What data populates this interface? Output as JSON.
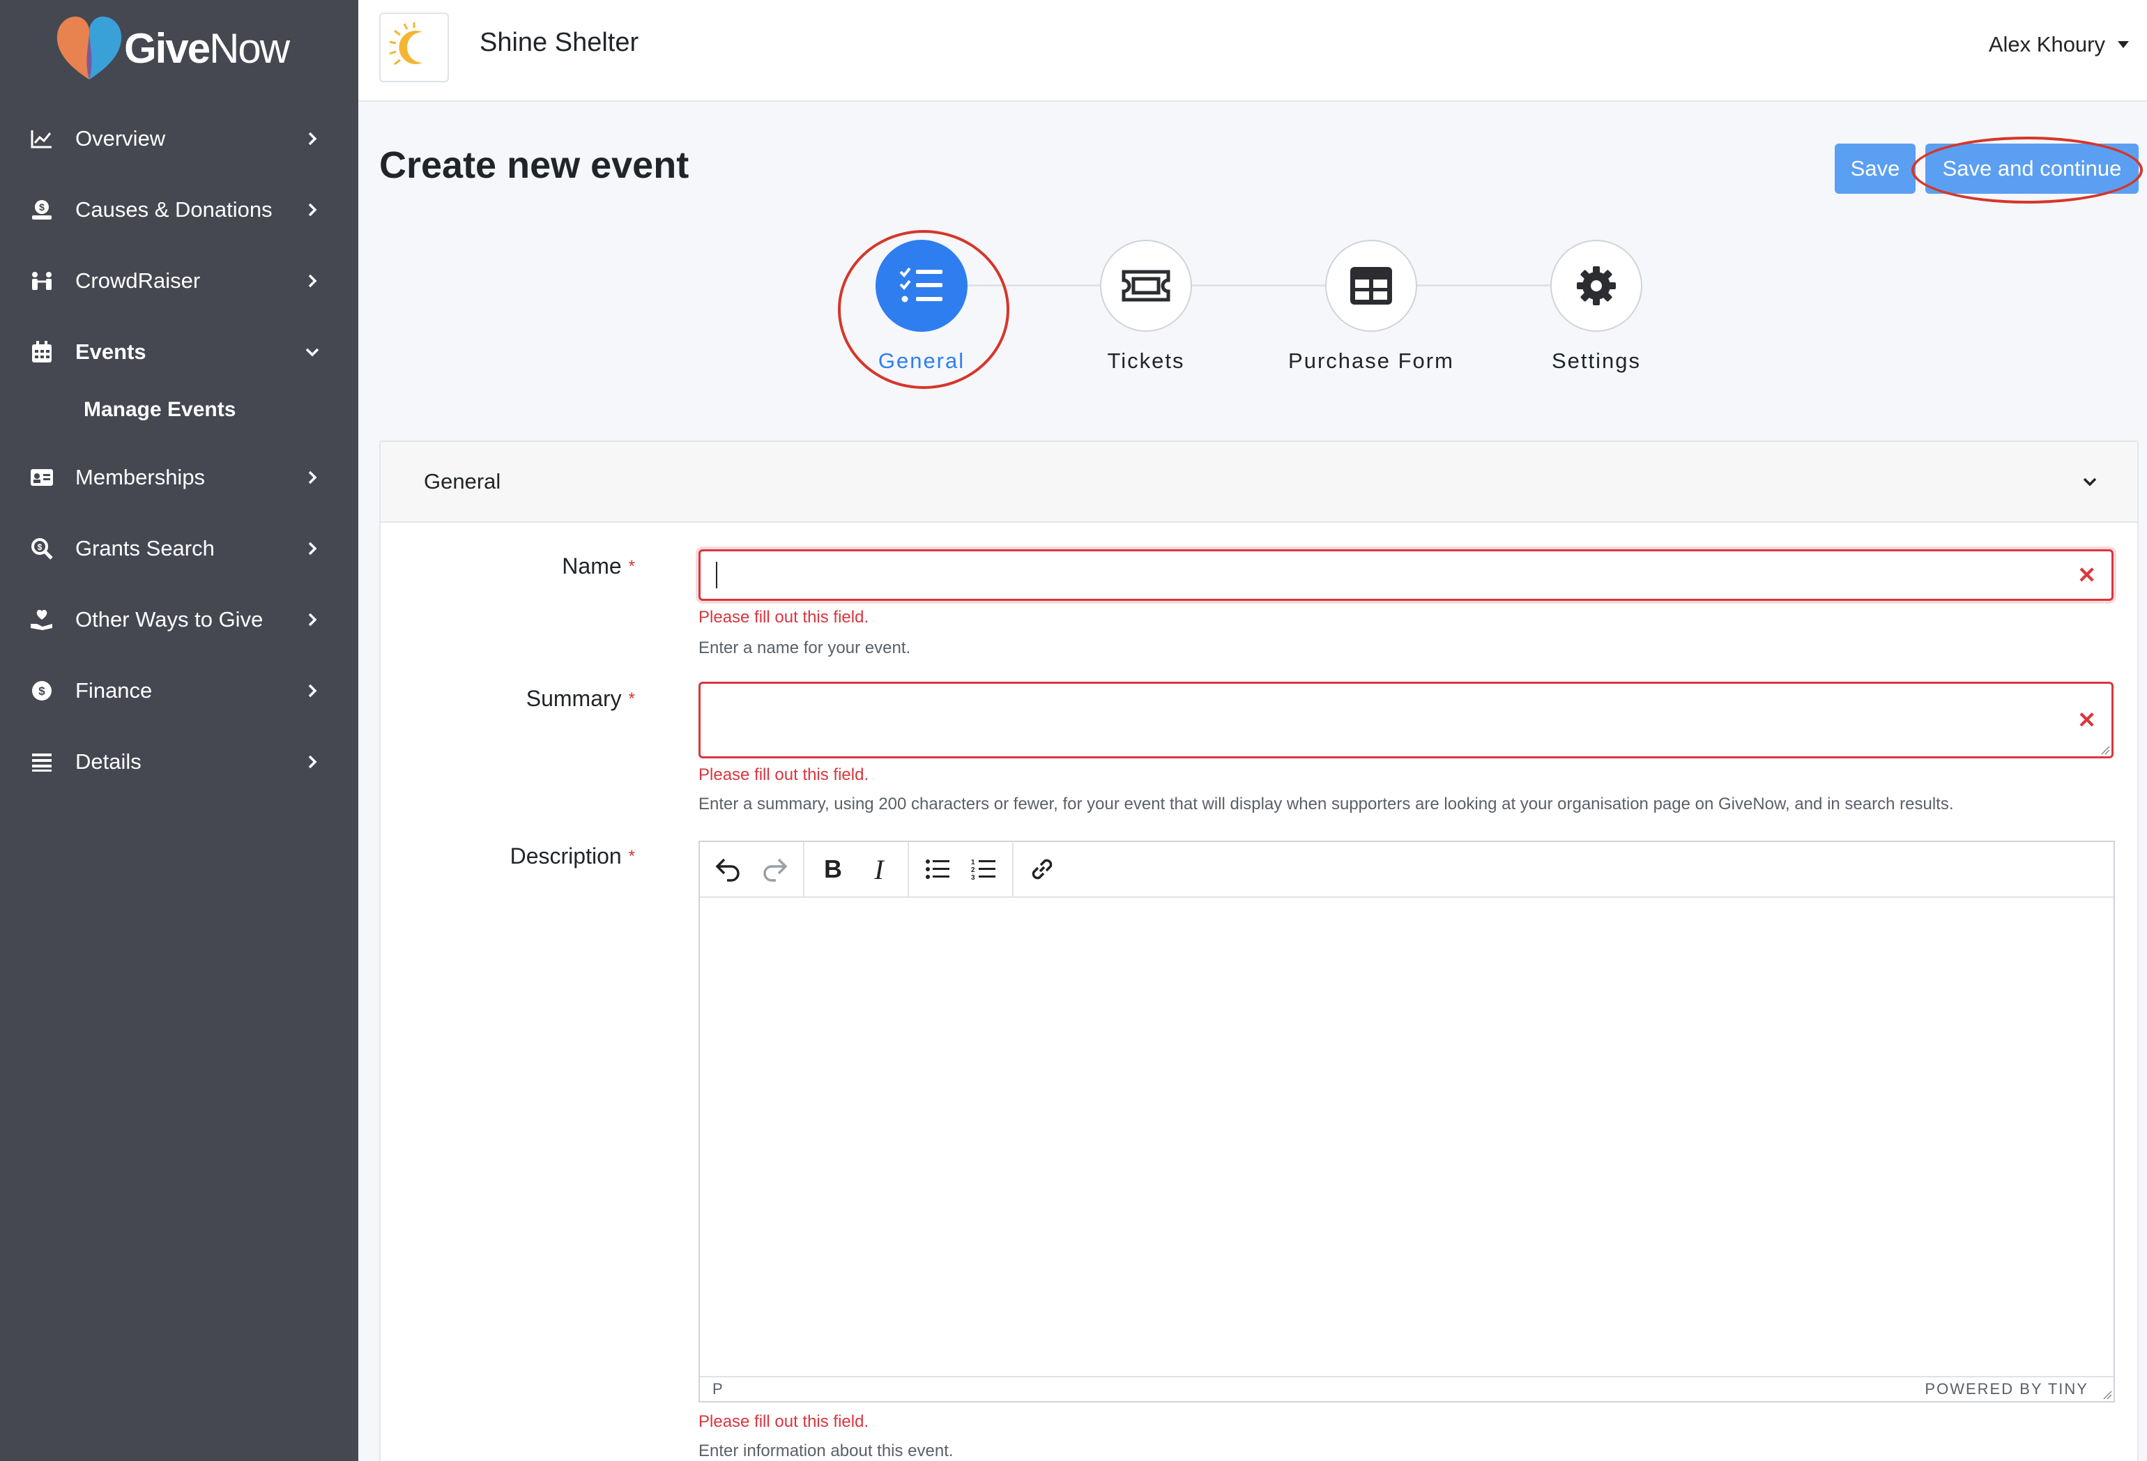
{
  "brand": {
    "logo_give": "Give",
    "logo_now": "Now"
  },
  "sidebar": {
    "items": [
      {
        "label": "Overview"
      },
      {
        "label": "Causes & Donations"
      },
      {
        "label": "CrowdRaiser"
      },
      {
        "label": "Events"
      },
      {
        "label": "Memberships"
      },
      {
        "label": "Grants Search"
      },
      {
        "label": "Other Ways to Give"
      },
      {
        "label": "Finance"
      },
      {
        "label": "Details"
      }
    ],
    "events_subitem": "Manage Events"
  },
  "header": {
    "org_name": "Shine Shelter",
    "user_name": "Alex Khoury"
  },
  "page": {
    "title": "Create new event"
  },
  "actions": {
    "save": "Save",
    "save_continue": "Save and continue"
  },
  "steps": [
    {
      "label": "General",
      "active": true
    },
    {
      "label": "Tickets",
      "active": false
    },
    {
      "label": "Purchase Form",
      "active": false
    },
    {
      "label": "Settings",
      "active": false
    }
  ],
  "section": {
    "title": "General"
  },
  "form": {
    "name": {
      "label": "Name",
      "required": "*",
      "error": "Please fill out this field.",
      "hint": "Enter a name for your event.",
      "value": ""
    },
    "summary": {
      "label": "Summary",
      "required": "*",
      "error": "Please fill out this field.",
      "hint": "Enter a summary, using 200 characters or fewer, for your event that will display when supporters are looking at your organisation page on GiveNow, and in search results.",
      "value": ""
    },
    "description": {
      "label": "Description",
      "required": "*",
      "error": "Please fill out this field.",
      "hint": "Enter information about this event.",
      "status_path": "P",
      "powered_by": "POWERED BY TINY"
    }
  },
  "colors": {
    "sidebar_bg": "#454851",
    "accent": "#2f7ef0",
    "button": "#5b9ff2",
    "error": "#d9363e",
    "annotation": "#d6362a"
  }
}
